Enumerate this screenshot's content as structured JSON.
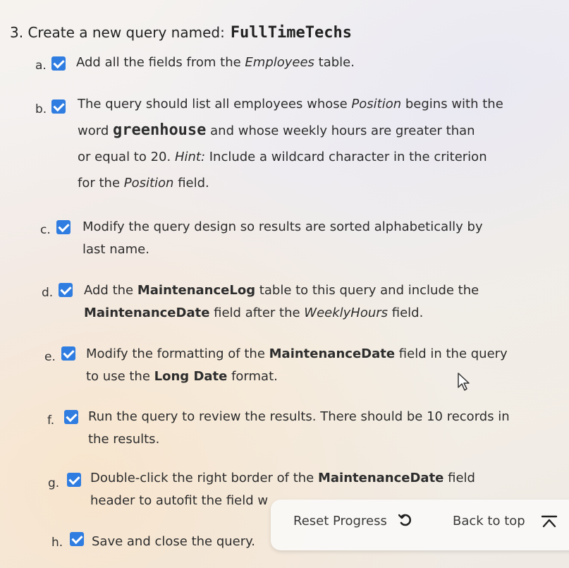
{
  "heading": {
    "number": "3. Create a new query named:",
    "query_name": "FullTimeTechs"
  },
  "steps": [
    {
      "letter": "a.",
      "parts": [
        "Add all the fields from the ",
        "Employees",
        " table."
      ]
    },
    {
      "letter": "b.",
      "lines": [
        "The query should list all employees whose ",
        "Position",
        " begins with the",
        "word ",
        "greenhouse",
        " and whose weekly hours are greater than",
        "or equal to 20. ",
        "Hint:",
        " Include a wildcard character in the criterion",
        "for the ",
        "Position",
        " field."
      ]
    },
    {
      "letter": "c.",
      "lines": [
        "Modify the query design so results are sorted alphabetically by",
        "last name."
      ]
    },
    {
      "letter": "d.",
      "lines": [
        "Add the ",
        "MaintenanceLog",
        " table to this query and include the",
        "MaintenanceDate",
        " field after the ",
        "WeeklyHours",
        " field."
      ]
    },
    {
      "letter": "e.",
      "lines": [
        "Modify the formatting of the ",
        "MaintenanceDate",
        " field in the query",
        "to use the ",
        "Long Date",
        " format."
      ]
    },
    {
      "letter": "f.",
      "lines": [
        "Run the query to review the results. There should be 10 records in",
        "the results."
      ]
    },
    {
      "letter": "g.",
      "lines": [
        "Double-click the right border of the ",
        "MaintenanceDate",
        " field",
        "header to autofit the field w"
      ]
    },
    {
      "letter": "h.",
      "parts": [
        "Save and close the query."
      ]
    }
  ],
  "bottom_bar": {
    "reset_label": "Reset Progress",
    "back_label": "Back to top"
  },
  "colors": {
    "checkbox": "#2f7de1"
  }
}
